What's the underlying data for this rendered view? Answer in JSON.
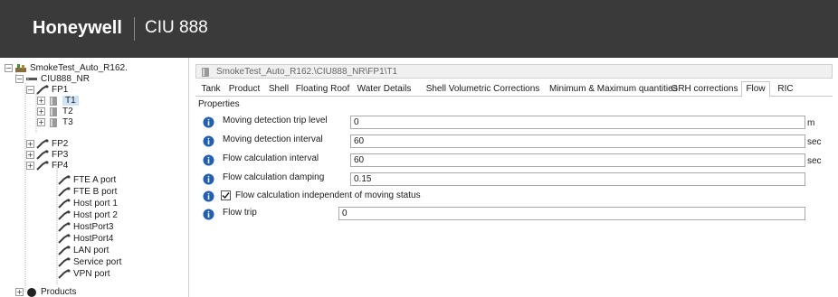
{
  "header": {
    "brand": "Honeywell",
    "product": "CIU 888"
  },
  "tree": {
    "root": "SmokeTest_Auto_R162.",
    "ciu": "CIU888_NR",
    "fp1": "FP1",
    "t1": "T1",
    "t2": "T2",
    "t3": "T3",
    "fp2": "FP2",
    "fp3": "FP3",
    "fp4": "FP4",
    "ports": [
      "FTE A port",
      "FTE B port",
      "Host port 1",
      "Host port 2",
      "HostPort3",
      "HostPort4",
      "LAN port",
      "Service port",
      "VPN port"
    ],
    "products": "Products"
  },
  "path": "SmokeTest_Auto_R162.\\CIU888_NR\\FP1\\T1",
  "tabs": [
    "Tank",
    "Product",
    "Shell",
    "Floating Roof",
    "Water Details",
    "Shell Volumetric Corrections",
    "Minimum & Maximum quantities",
    "GRH corrections",
    "Flow",
    "RIC"
  ],
  "active_tab": "Flow",
  "properties": {
    "title": "Properties",
    "rows": [
      {
        "label": "Moving detection trip level",
        "value": "0",
        "unit": "m"
      },
      {
        "label": "Moving detection interval",
        "value": "60",
        "unit": "sec"
      },
      {
        "label": "Flow calculation interval",
        "value": "60",
        "unit": "sec"
      },
      {
        "label": "Flow calculation damping",
        "value": "0.15",
        "unit": ""
      }
    ],
    "checkbox": {
      "label": "Flow calculation independent of moving status",
      "checked": true
    },
    "flow_trip": {
      "label": "Flow trip",
      "value": "0"
    }
  }
}
